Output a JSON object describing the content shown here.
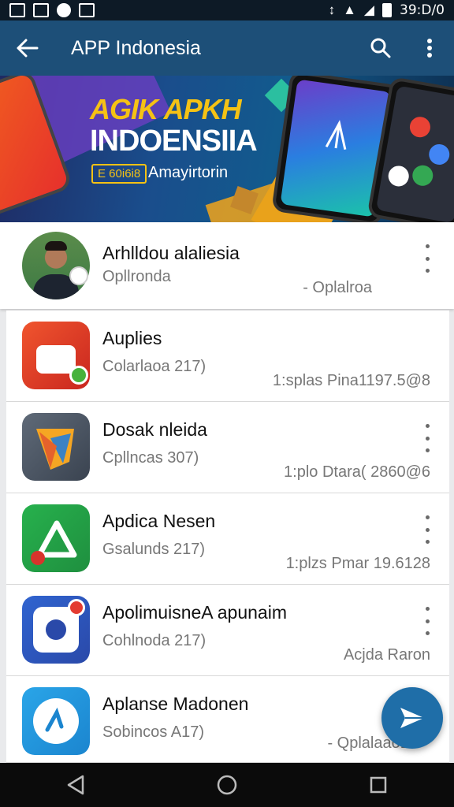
{
  "status_bar": {
    "time": "39:D/0"
  },
  "app_bar": {
    "title": "APP Indonesia"
  },
  "banner": {
    "headline_1": "AGIK APKH",
    "headline_2": "INDOENSIIA",
    "badge": "E 60i6i8",
    "subtitle": "Amayirtorin"
  },
  "featured": {
    "title": "Arhlldou alaliesia",
    "subtitle": "Opllronda",
    "meta": "- Oplalroa"
  },
  "apps": [
    {
      "title": "Auplies",
      "subtitle": "Colarlaoa 217)",
      "meta": "1:splas Pina1197.5@8",
      "has_more": false
    },
    {
      "title": "Dosak nleida",
      "subtitle": "Cpllncas 307)",
      "meta": "1:plo Dtara( 2860@6",
      "has_more": true
    },
    {
      "title": "Apdica Nesen",
      "subtitle": "Gsalunds 217)",
      "meta": "1:plzs Pmar 19.6128",
      "has_more": true
    },
    {
      "title": "ApolimuisneA apunaim",
      "subtitle": "Cohlnoda 217)",
      "meta": "Acjda Raron",
      "has_more": true
    },
    {
      "title": "Aplanse Madonen",
      "subtitle": "Sobincos A17)",
      "meta": "- Qplalaao19",
      "has_more": false
    }
  ],
  "colors": {
    "app_bar": "#1d4f78",
    "status_bar": "#0d1a26",
    "fab": "#1f6ea8"
  }
}
